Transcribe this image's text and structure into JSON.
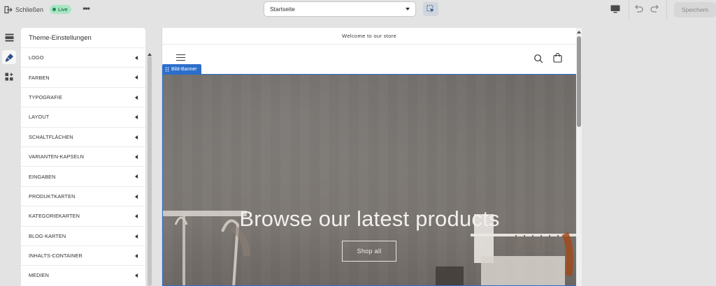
{
  "topbar": {
    "exit_label": "Schließen",
    "status_badge": "Live",
    "more_label": "•••",
    "page_select": "Startseite",
    "save_label": "Speichern"
  },
  "sidebar": {
    "title": "Theme-Einstellungen",
    "items": [
      {
        "label": "LOGO"
      },
      {
        "label": "FARBEN"
      },
      {
        "label": "TYPOGRAFIE"
      },
      {
        "label": "LAYOUT"
      },
      {
        "label": "SCHALTFLÄCHEN"
      },
      {
        "label": "VARIANTEN-KAPSELN"
      },
      {
        "label": "EINGABEN"
      },
      {
        "label": "PRODUKTKARTEN"
      },
      {
        "label": "KATEGORIEKARTEN"
      },
      {
        "label": "BLOG-KARTEN"
      },
      {
        "label": "INHALTS-CONTAINER"
      },
      {
        "label": "MEDIEN"
      }
    ]
  },
  "preview": {
    "announcement": "Welcome to our store",
    "section_tag": "Bild-Banner",
    "banner_heading": "Browse our latest products",
    "banner_button": "Shop all"
  },
  "colors": {
    "accent": "#2c6ecb",
    "live_badge_bg": "#a8e6c4",
    "live_badge_text": "#0c5132"
  }
}
